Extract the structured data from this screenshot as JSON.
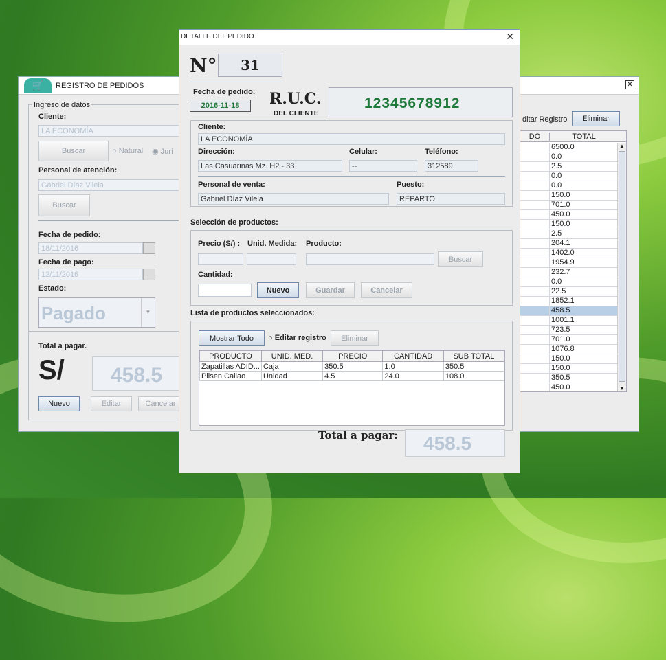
{
  "background_window": {
    "title": "REGISTRO DE PEDIDOS",
    "ingreso_label": "Ingreso de datos",
    "cliente_label": "Cliente:",
    "cliente_value": "LA ECONOMÍA",
    "buscar1": "Buscar",
    "radio_natural": "Natural",
    "radio_juridica": "Jurí",
    "personal_label": "Personal de atención:",
    "personal_value": "Gabriel Díaz Vilela",
    "buscar2": "Buscar",
    "fecha_pedido_label": "Fecha de pedido:",
    "fecha_pedido_value": "18/11/2016",
    "fecha_pago_label": "Fecha de pago:",
    "fecha_pago_value": "12/11/2016",
    "estado_label": "Estado:",
    "estado_value": "Pagado",
    "total_label": "Total a pagar.",
    "currency": "S/",
    "total_value": "458.5",
    "nuevo": "Nuevo",
    "editar": "Editar",
    "cancelar": "Cancelar",
    "editar_registro": "ditar Registro",
    "eliminar": "Eliminar",
    "table_headers": [
      "DO",
      "TOTAL"
    ],
    "totals": [
      "6500.0",
      "0.0",
      "2.5",
      "0.0",
      "0.0",
      "150.0",
      "701.0",
      "450.0",
      "150.0",
      "2.5",
      "204.1",
      "1402.0",
      "1954.9",
      "232.7",
      "0.0",
      "22.5",
      "1852.1",
      "458.5",
      "1001.1",
      "723.5",
      "701.0",
      "1076.8",
      "150.0",
      "150.0",
      "350.5",
      "450.0"
    ],
    "selected_index": 17
  },
  "dialog": {
    "title": "DETALLE DEL PEDIDO",
    "numero_label": "N°",
    "numero_value": "31",
    "fecha_label": "Fecha de pedido:",
    "fecha_value": "2016-11-18",
    "ruc_label": "R.U.C.",
    "ruc_sub": "DEL CLIENTE",
    "ruc_value": "12345678912",
    "cliente_label": "Cliente:",
    "cliente_value": "LA ECONOMÍA",
    "direccion_label": "Dirección:",
    "direccion_value": "Las Casuarinas Mz. H2 - 33",
    "celular_label": "Celular:",
    "celular_value": "--",
    "telefono_label": "Teléfono:",
    "telefono_value": "312589",
    "personal_label": "Personal de venta:",
    "personal_value": "Gabriel Díaz Vilela",
    "puesto_label": "Puesto:",
    "puesto_value": "REPARTO",
    "seleccion_label": "Selección de productos:",
    "precio_label": "Precio (S/) :",
    "unid_label": "Unid. Medida:",
    "producto_label": "Producto:",
    "buscar": "Buscar",
    "cantidad_label": "Cantidad:",
    "nuevo": "Nuevo",
    "guardar": "Guardar",
    "cancelar": "Cancelar",
    "lista_label": "Lista de productos seleccionados:",
    "mostrar_todo": "Mostrar Todo",
    "editar_registro": "Editar registro",
    "eliminar": "Eliminar",
    "columns": [
      "PRODUCTO",
      "UNID. MED.",
      "PRECIO",
      "CANTIDAD",
      "SUB TOTAL"
    ],
    "rows": [
      [
        "Zapatillas ADID...",
        "Caja",
        "350.5",
        "1.0",
        "350.5"
      ],
      [
        "Pilsen Callao",
        "Unidad",
        "4.5",
        "24.0",
        "108.0"
      ]
    ],
    "total_label": "Total a pagar:",
    "total_value": "458.5",
    "ruc_color": "#1f7a3a"
  }
}
